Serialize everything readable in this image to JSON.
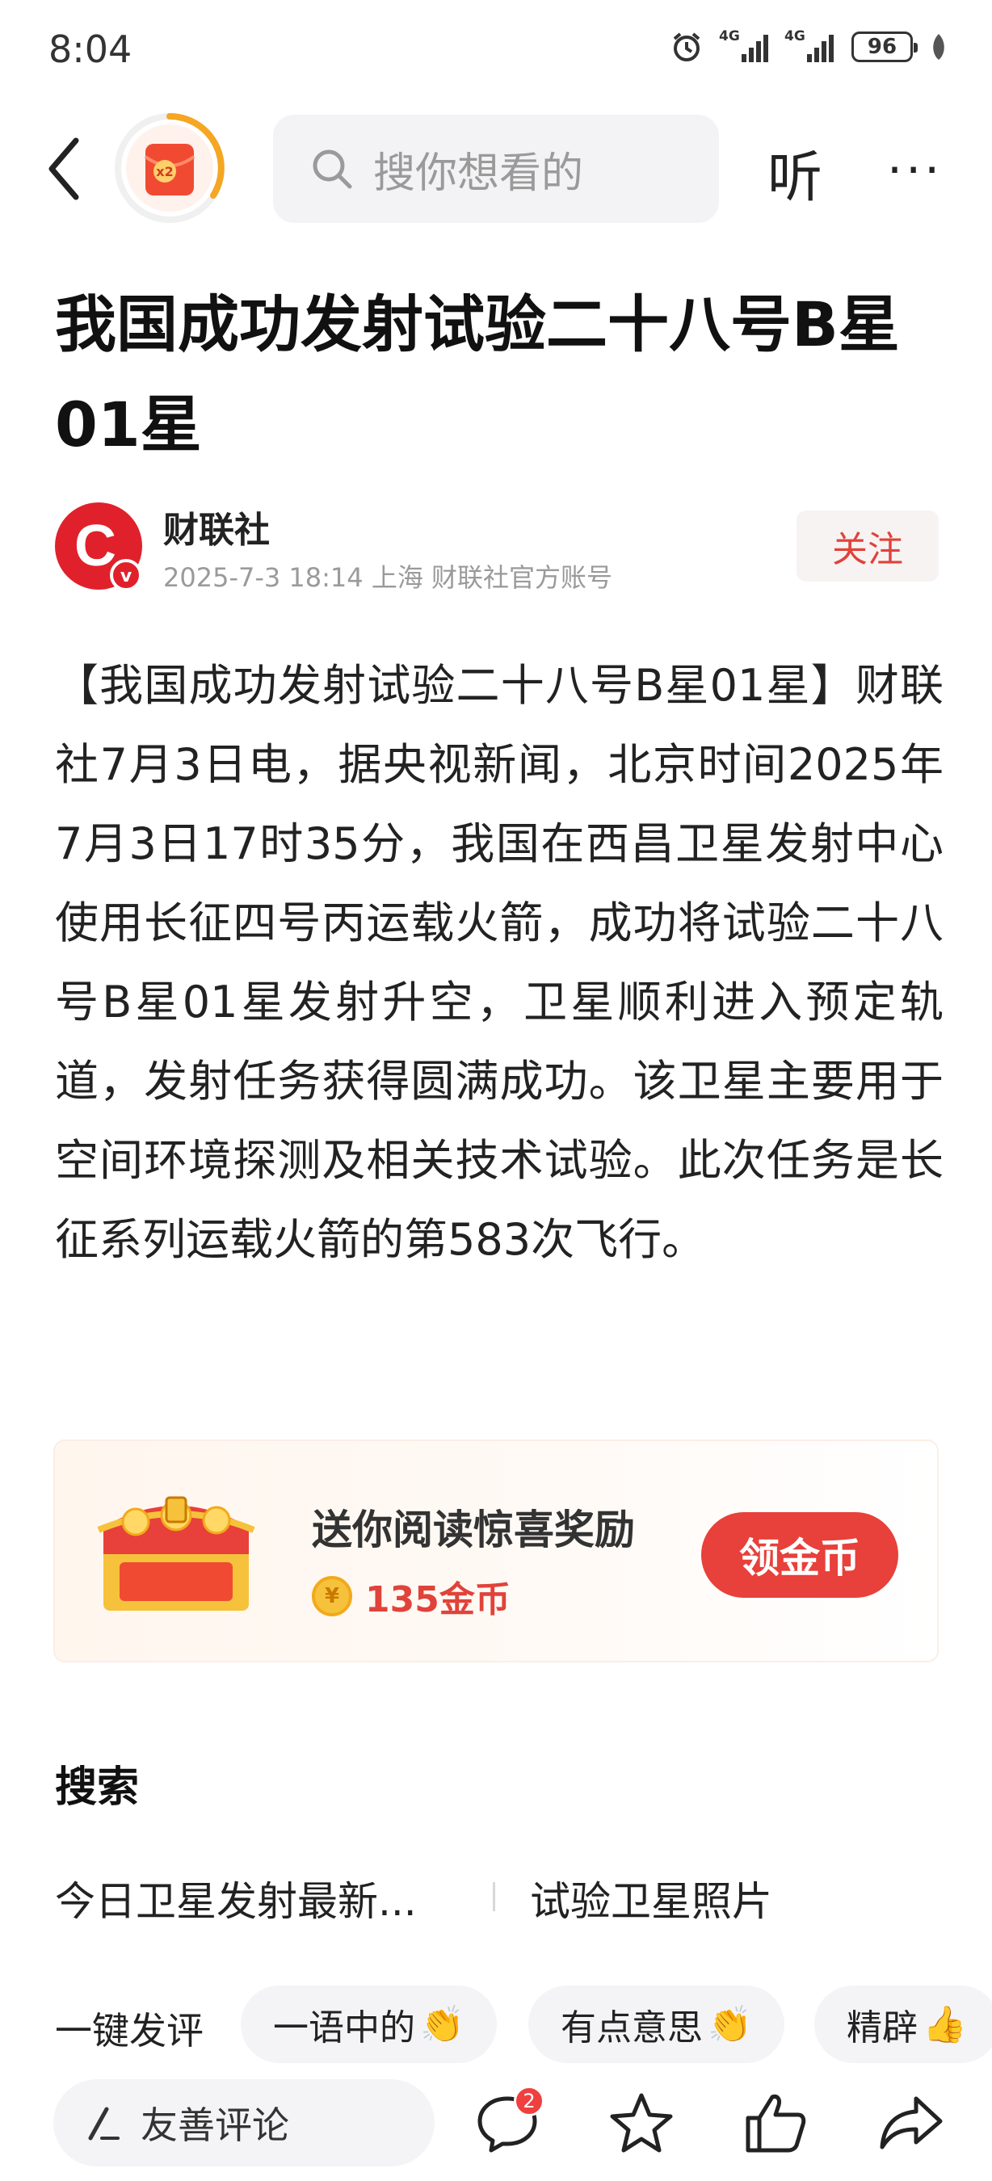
{
  "status_bar": {
    "time": "8:04",
    "signal1_tag": "4G",
    "signal2_tag": "4G",
    "battery": "96"
  },
  "nav": {
    "reward_badge": "x2",
    "search_placeholder": "搜你想看的",
    "listen_label": "听",
    "more_label": "···"
  },
  "article": {
    "title": "我国成功发射试验二十八号B星01星",
    "author": {
      "name": "财联社",
      "logo_letter": "C",
      "verified_mark": "v",
      "meta": "2025-7-3  18:14  上海  财联社官方账号",
      "follow_label": "关注"
    },
    "body": "【我国成功发射试验二十八号B星01星】财联社7月3日电，据央视新闻，北京时间2025年7月3日17时35分，我国在西昌卫星发射中心使用长征四号丙运载火箭，成功将试验二十八号B星01星发射升空，卫星顺利进入预定轨道，发射任务获得圆满成功。该卫星主要用于空间环境探测及相关技术试验。此次任务是长征系列运载火箭的第583次飞行。"
  },
  "reward": {
    "title": "送你阅读惊喜奖励",
    "coin_symbol": "¥",
    "coins": "135金币",
    "button": "领金币"
  },
  "search_section": {
    "title": "搜索",
    "suggestions": [
      "今日卫星发射最新...",
      "试验卫星照片"
    ]
  },
  "quick_comments": {
    "label": "一键发评",
    "chips": [
      {
        "text": "一语中的",
        "emoji": "👏"
      },
      {
        "text": "有点意思",
        "emoji": "👏"
      },
      {
        "text": "精辟",
        "emoji": "👍"
      }
    ]
  },
  "bottom_bar": {
    "comment_placeholder": "友善评论",
    "comment_count": "2"
  },
  "colors": {
    "accent_red": "#e8403a",
    "follow_text": "#e0433a",
    "gray_text": "#9a9a9a"
  }
}
